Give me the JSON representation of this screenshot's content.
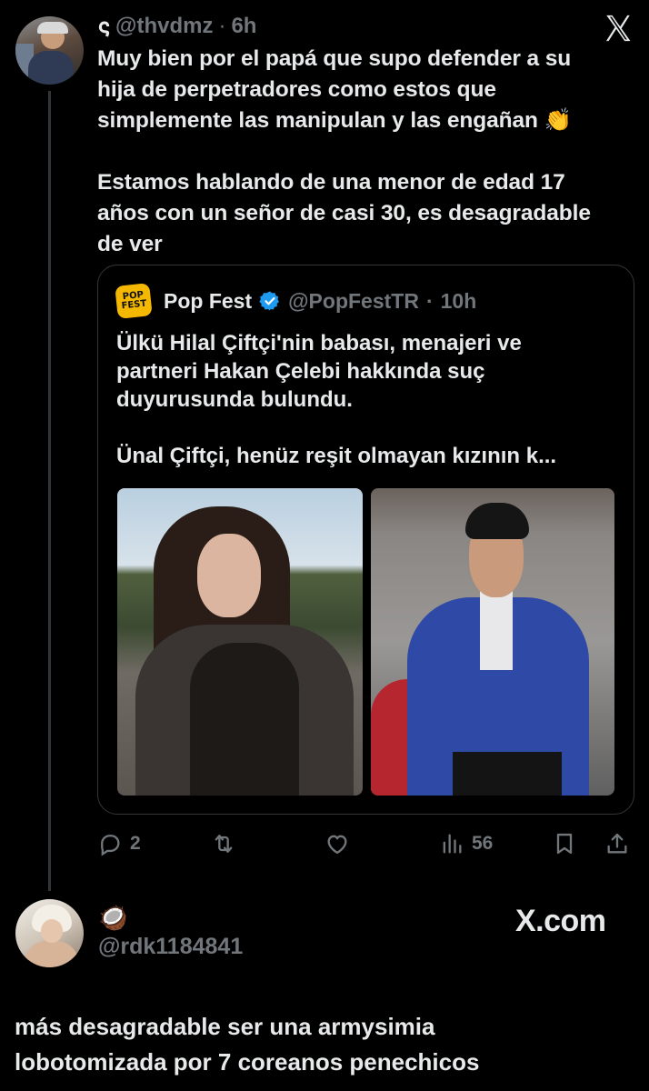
{
  "tweet": {
    "handle": "@thvdmz",
    "time": "6h",
    "text_p1": "Muy bien por el papá que supo defender a su\nhija de perpetradores como estos que\nsimplemente las manipulan y las engañan 👏",
    "text_p2": "Estamos hablando de una menor de edad 17\naños con un señor de casi 30, es desagradable\nde ver"
  },
  "quote": {
    "logo_line1": "POP",
    "logo_line2": "FEST",
    "name": "Pop Fest",
    "handle": "@PopFestTR",
    "time": "10h",
    "text_p1": "Ülkü Hilal Çiftçi'nin babası, menajeri ve\npartneri Hakan Çelebi hakkında suç\nduyurusunda bulundu.",
    "text_p2": "Ünal Çiftçi, henüz reşit olmayan kızının k..."
  },
  "actions": {
    "replies": "2",
    "views": "56"
  },
  "reply": {
    "handle": "@rdk1184841",
    "emoji": "🥥",
    "watermark": "X.com",
    "text": "más desagradable ser una armysimia\nlobotomizada por 7 coreanos penechicos"
  },
  "colors": {
    "background": "#000000",
    "text": "#e7e9ea",
    "muted": "#71767b",
    "border": "#333639",
    "verified": "#1d9bf0"
  }
}
